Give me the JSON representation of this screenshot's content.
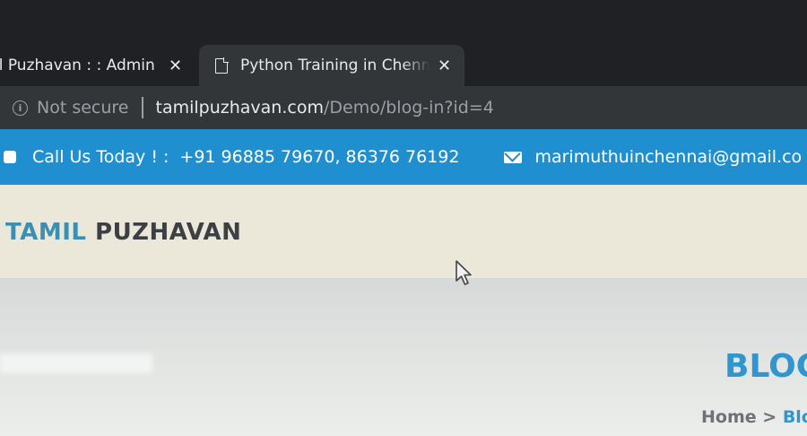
{
  "browser": {
    "tabs": [
      {
        "title": "il Puzhavan : : Admin",
        "close": "✕",
        "active": false
      },
      {
        "title": "Python Training in Chenn",
        "close": "✕",
        "active": true
      }
    ],
    "omnibox": {
      "security_label": "Not secure",
      "url_host": "tamilpuzhavan.com",
      "url_path": "/Demo/blog-in?id=4"
    }
  },
  "topbar": {
    "call_label": "Call Us Today ! :",
    "phone_numbers": "+91 96885 79670, 86376 76192",
    "email": "marimuthuinchennai@gmail.co",
    "background": "#1f8fd0"
  },
  "header": {
    "logo_part1": "TAMIL",
    "logo_part2": "PUZHAVAN"
  },
  "content": {
    "page_title": "BLOG",
    "breadcrumb": {
      "home": "Home",
      "separator": ">",
      "current": "Blo"
    }
  },
  "colors": {
    "accent": "#2f96cf",
    "logo_blue": "#3a8fb2",
    "logo_dark": "#3c3f44"
  }
}
